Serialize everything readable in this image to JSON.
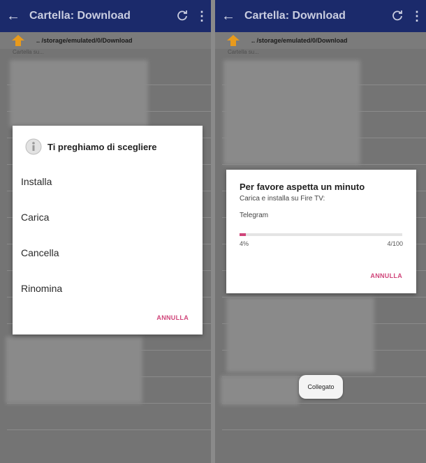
{
  "left": {
    "appbar": {
      "back_icon": "arrow-back-icon",
      "title": "Cartella: Download",
      "refresh_icon": "refresh-icon",
      "more_icon": "more-vert-icon"
    },
    "path": ".. /storage/emulated/0/Download",
    "subtitle": "Cartella su...",
    "dialog": {
      "title": "Ti preghiamo di scegliere",
      "options": [
        "Installa",
        "Carica",
        "Cancella",
        "Rinomina"
      ],
      "cancel": "ANNULLA"
    }
  },
  "right": {
    "appbar": {
      "back_icon": "arrow-back-icon",
      "title": "Cartella: Download",
      "refresh_icon": "refresh-icon",
      "more_icon": "more-vert-icon"
    },
    "path": ".. /storage/emulated/0/Download",
    "subtitle": "Cartella su...",
    "dialog": {
      "title": "Per favore aspetta un minuto",
      "message": "Carica e installa su Fire TV:",
      "file": "Telegram",
      "progress_percent": 4,
      "progress_label": "4%",
      "count_label": "4/100",
      "cancel": "ANNULLA"
    },
    "toast": "Collegato"
  },
  "colors": {
    "appbar": "#1b2a6b",
    "accent": "#d0457a",
    "scrim": "#747474"
  }
}
